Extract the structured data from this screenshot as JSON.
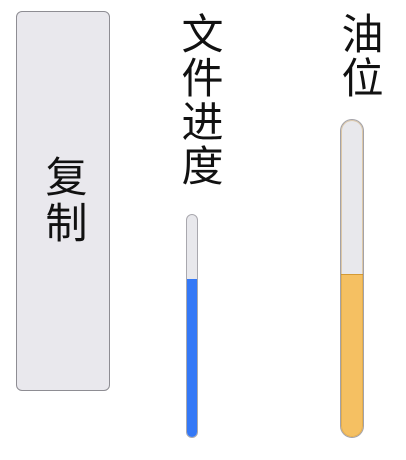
{
  "copy_button": {
    "label": "复制"
  },
  "file_progress": {
    "title": "文件进度",
    "value": 0.71,
    "fill_color": "#3478f6"
  },
  "fuel_level": {
    "title": "油位",
    "value": 0.51,
    "fill_color": "#f5c062"
  }
}
